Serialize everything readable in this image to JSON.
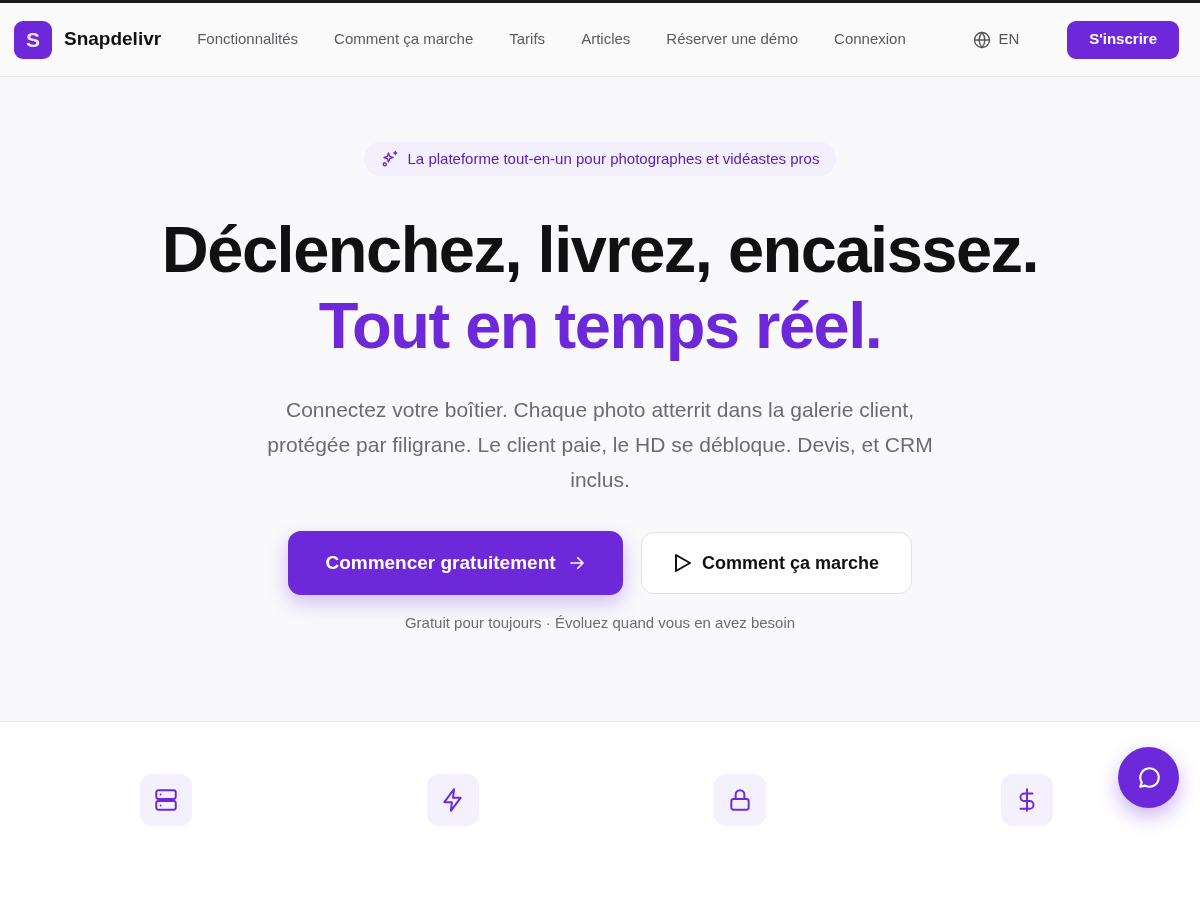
{
  "nav": {
    "brand_initial": "S",
    "brand_name": "Snapdelivr",
    "links": [
      "Fonctionnalités",
      "Comment ça marche",
      "Tarifs",
      "Articles",
      "Réserver une démo",
      "Connexion"
    ],
    "language": "EN",
    "signup": "S'inscrire"
  },
  "hero": {
    "badge": "La plateforme tout-en-un pour photographes et vidéastes pros",
    "title": "Déclenchez, livrez, encaissez.",
    "title_accent": "Tout en temps réel.",
    "description": "Connectez votre boîtier. Chaque photo atterrit dans la galerie client, protégée par filigrane. Le client paie, le HD se débloque. Devis, et CRM inclus.",
    "primary_button": "Commencer gratuitement",
    "secondary_button": "Comment ça marche",
    "note": "Gratuit pour toujours · Évoluez quand vous en avez besoin"
  }
}
